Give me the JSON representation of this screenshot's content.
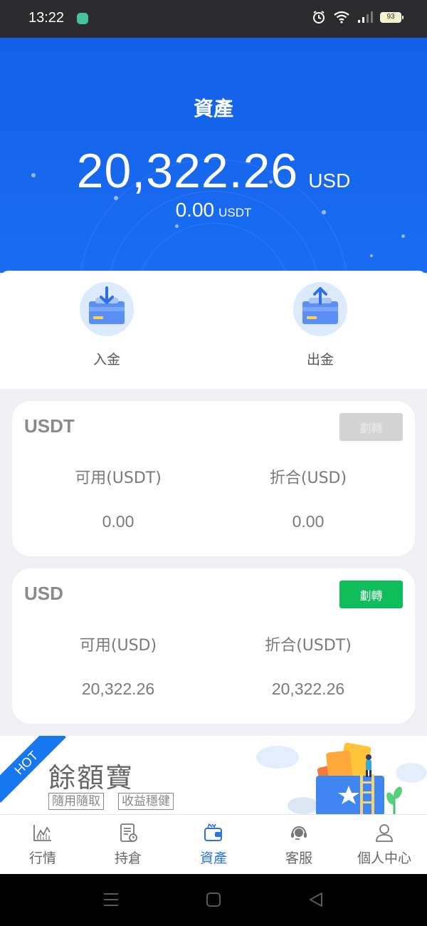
{
  "status_bar": {
    "time": "13:22",
    "battery": "93",
    "icons": [
      "alarm-icon",
      "wifi-icon",
      "signal-icon",
      "battery-icon"
    ]
  },
  "hero": {
    "title": "資產",
    "total_amount": "20,322.26",
    "total_unit": "USD",
    "sub_amount": "0.00",
    "sub_unit": "USDT"
  },
  "actions": {
    "deposit_label": "入金",
    "withdraw_label": "出金"
  },
  "cards": [
    {
      "currency": "USDT",
      "transfer_label": "劃轉",
      "transfer_enabled": false,
      "available_label": "可用(USDT)",
      "available_value": "0.00",
      "equivalent_label": "折合(USD)",
      "equivalent_value": "0.00"
    },
    {
      "currency": "USD",
      "transfer_label": "劃轉",
      "transfer_enabled": true,
      "available_label": "可用(USD)",
      "available_value": "20,322.26",
      "equivalent_label": "折合(USDT)",
      "equivalent_value": "20,322.26"
    }
  ],
  "promo": {
    "hot_label": "HOT",
    "title": "餘額寶",
    "tags": [
      "隨用隨取",
      "收益穩健"
    ]
  },
  "bottom_nav": {
    "items": [
      {
        "label": "行情",
        "icon": "chart-icon",
        "active": false
      },
      {
        "label": "持倉",
        "icon": "document-icon",
        "active": false
      },
      {
        "label": "資產",
        "icon": "wallet-icon",
        "active": true
      },
      {
        "label": "客服",
        "icon": "headset-icon",
        "active": false
      },
      {
        "label": "個人中心",
        "icon": "user-icon",
        "active": false
      }
    ]
  },
  "colors": {
    "primary_blue": "#1a6df2",
    "transfer_green": "#0fbe5b",
    "nav_active": "#2a73e0"
  }
}
